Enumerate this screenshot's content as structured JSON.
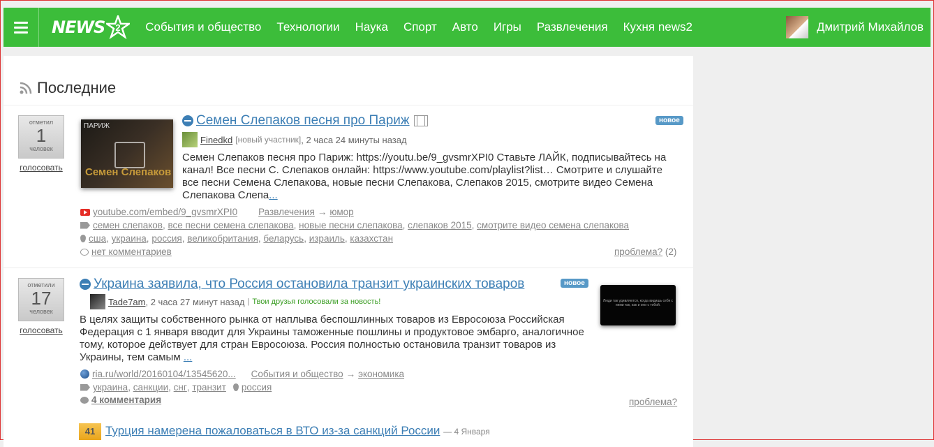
{
  "topbar": {
    "logo_text": "NEWS",
    "logo_mark_text": "2",
    "nav": [
      "События и общество",
      "Технологии",
      "Наука",
      "Спорт",
      "Авто",
      "Игры",
      "Развлечения",
      "Кухня news2"
    ],
    "user_name": "Дмитрий Михайлов"
  },
  "section": {
    "title": "Последние"
  },
  "items": [
    {
      "vote_top": "отметил",
      "vote_count": "1",
      "vote_bottom": "человек",
      "vote_link": "голосовать",
      "thumb_top": "ПАРИЖ",
      "thumb_caption": "Семен Слепаков",
      "title": "Семен Слепаков песня про Париж",
      "badge": "новое",
      "author": "Finedkd",
      "author_note": "[новый участник]",
      "time": ", 2 часа 24 минуты назад",
      "desc": "Семен Слепаков песня про Париж: https://youtu.be/9_gvsmrXPI0 Ставьте ЛАЙК, подписывайтесь на канал! Все песни С. Слепаков онлайн: https://www.youtube.com/playlist?list… Смотрите и слушайте все песни Семена Слепакова, новые песни Слепакова, Слепаков 2015, смотрите видео Семена Слепакова Слепа",
      "more": "...",
      "source": "youtube.com/embed/9_gvsmrXPI0",
      "category": "Развлечения",
      "arrow": "→",
      "subcategory": "юмор",
      "tags": [
        "семен слепаков",
        "все песни семена слепакова",
        "новые песни слепакова",
        "слепаков 2015",
        "смотрите видео семена слепакова"
      ],
      "places": [
        "сша",
        "украина",
        "россия",
        "великобритания",
        "беларусь",
        "израиль",
        "казахстан"
      ],
      "comments": "нет комментариев",
      "problem": "проблема?",
      "problem_count": "(2)"
    },
    {
      "vote_top": "отметили",
      "vote_count": "17",
      "vote_bottom": "человек",
      "vote_link": "голосовать",
      "thumb_text": "Люди так удивляются, когда видишь себя с ними так, как и они с тобой.",
      "title": "Украина заявила, что Россия остановила транзит украинских товаров",
      "badge": "новое",
      "author": "Tade7am",
      "time": ", 2 часа 27 минут назад",
      "bar": "|",
      "friends": "Твои друзья голосовали за новость!",
      "desc": "В целях защиты собственного рынка от наплыва беспошлинных товаров из Евросоюза Российская Федерация с 1 января вводит для Украины таможенные пошлины и продуктовое эмбарго, аналогичное тому, которое действует для стран Евросоюза. Россия полностью остановила транзит товаров из Украины, тем самым",
      "more": "...",
      "source": "ria.ru/world/20160104/13545620...",
      "category": "События и общество",
      "arrow": "→",
      "subcategory": "экономика",
      "tags": [
        "украина",
        "санкции",
        "снг",
        "транзит"
      ],
      "places": [
        "россия"
      ],
      "comments": "4 комментария",
      "problem": "проблема?"
    },
    {
      "rank": "41",
      "title": "Турция намерена пожаловаться в ВТО из-за санкций России",
      "date": "— 4 Января"
    }
  ],
  "colors": {
    "brand": "#3cbd3a",
    "link": "#3d7fb5",
    "badge": "#5799c7",
    "friends": "#3a9d23"
  }
}
